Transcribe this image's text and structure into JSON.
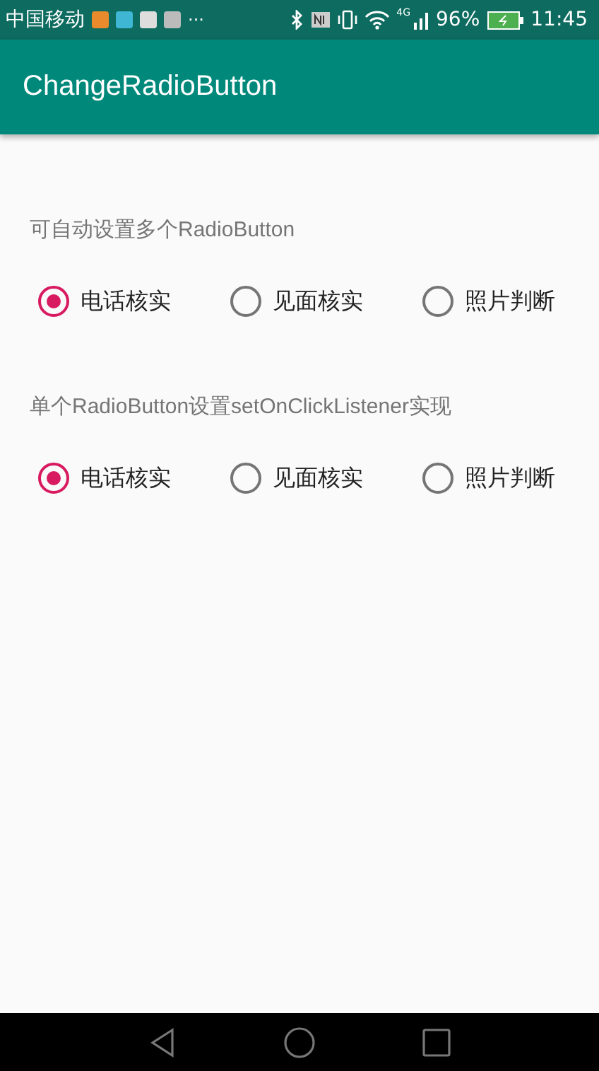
{
  "status_bar": {
    "carrier": "中国移动",
    "more": "···",
    "network": "4G",
    "battery": "96%",
    "time": "11:45"
  },
  "app_bar": {
    "title": "ChangeRadioButton"
  },
  "groups": [
    {
      "label": "可自动设置多个RadioButton",
      "options": [
        {
          "label": "电话核实",
          "selected": true
        },
        {
          "label": "见面核实",
          "selected": false
        },
        {
          "label": "照片判断",
          "selected": false
        }
      ]
    },
    {
      "label": "单个RadioButton设置setOnClickListener实现",
      "options": [
        {
          "label": "电话核实",
          "selected": true
        },
        {
          "label": "见面核实",
          "selected": false
        },
        {
          "label": "照片判断",
          "selected": false
        }
      ]
    }
  ]
}
